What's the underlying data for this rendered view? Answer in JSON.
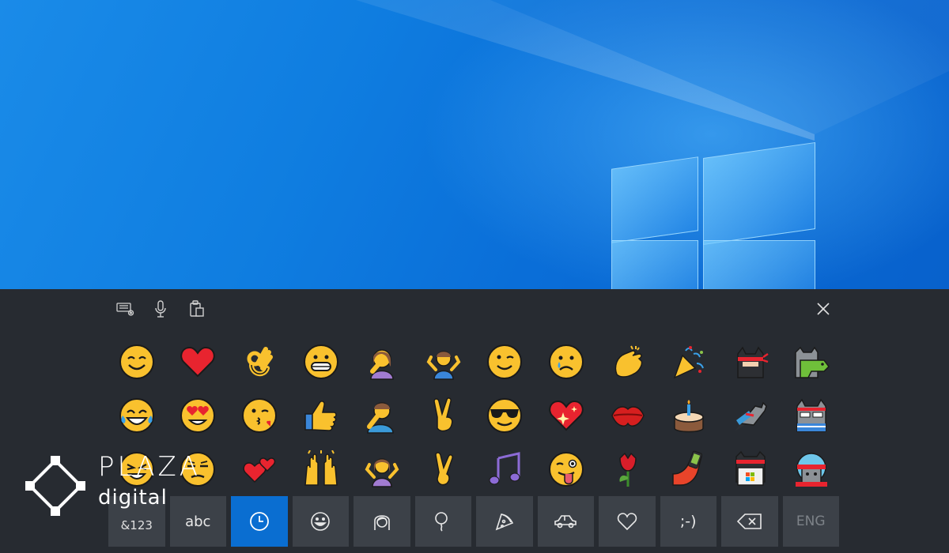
{
  "watermark": {
    "brand_line1": "PLAZA",
    "brand_line2": "digital"
  },
  "toolbar": {
    "icons": [
      "keyboard-settings-icon",
      "microphone-icon",
      "clipboard-icon"
    ],
    "close_icon": "close-icon"
  },
  "emoji_rows": [
    [
      "smiling-face",
      "red-heart",
      "ok-hand",
      "grinning-face",
      "woman-facepalming",
      "man-shrugging",
      "winking-face",
      "crying-face",
      "clapping-hands",
      "party-popper",
      "ninja-cat",
      "dino-cat"
    ],
    [
      "tears-of-joy",
      "heart-eyes",
      "face-blowing-kiss",
      "thumbs-up",
      "person-facepalming",
      "victory-hand",
      "smiling-face-sunglasses",
      "sparkling-heart",
      "kiss-mark",
      "birthday-cake",
      "astro-cat",
      "hipster-cat"
    ],
    [
      "laughing-face",
      "unamused-face",
      "two-hearts",
      "raising-hands",
      "woman-shrugging",
      "crossed-fingers",
      "musical-notes",
      "face-with-tongue",
      "rose",
      "hand-with-phone",
      "hacker-cat",
      "stunt-cat"
    ]
  ],
  "keys": {
    "numbers": "&123",
    "letters": "abc",
    "recent_icon": "clock-icon",
    "smiley_icon": "smiley-icon",
    "people_icon": "person-icon",
    "celebration_icon": "balloon-icon",
    "food_icon": "pizza-icon",
    "travel_icon": "car-icon",
    "symbols_icon": "heart-icon",
    "emoticons": ";-)",
    "backspace_icon": "backspace-icon",
    "language": "ENG"
  },
  "colors": {
    "keyboard_bg": "#272b31",
    "key_bg": "#3c4148",
    "active_key": "#0a6ed1",
    "wallpaper": "#0a74d8"
  }
}
